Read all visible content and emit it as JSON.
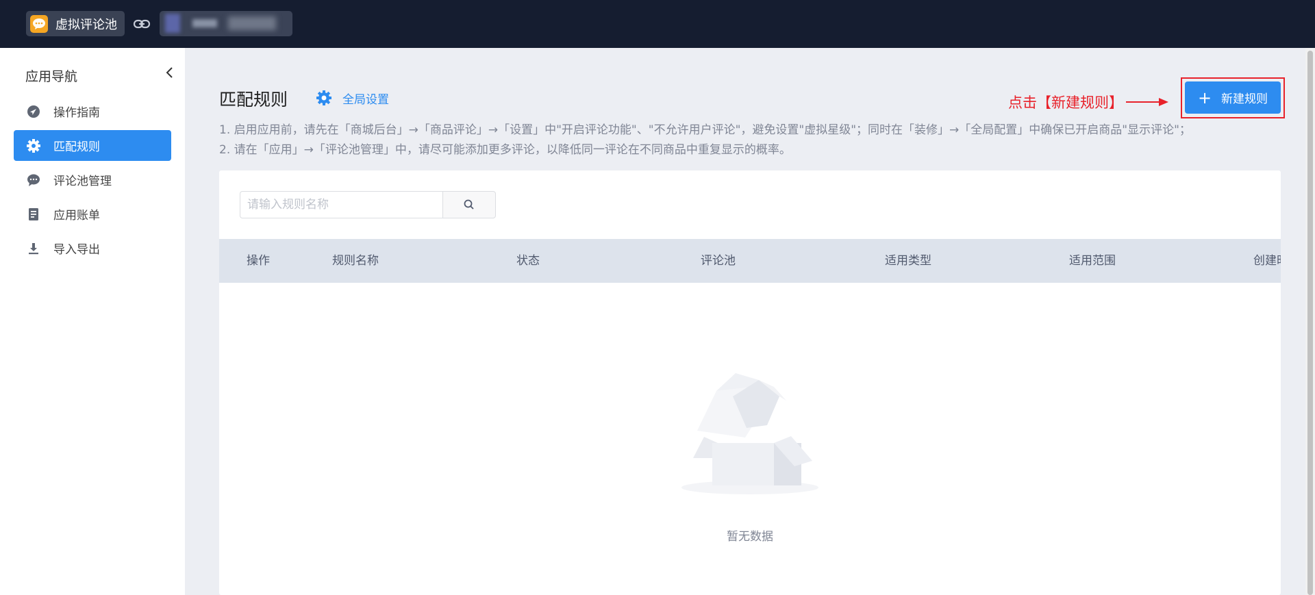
{
  "topbar": {
    "app_name": "虚拟评论池",
    "app_logo_icon": "chat-bubble-icon",
    "link_icon": "link-icon",
    "store_name": ""
  },
  "sidebar": {
    "title": "应用导航",
    "items": [
      {
        "label": "操作指南",
        "icon": "navigation-arrow-icon",
        "active": false
      },
      {
        "label": "匹配规则",
        "icon": "gear-icon",
        "active": true
      },
      {
        "label": "评论池管理",
        "icon": "comment-icon",
        "active": false
      },
      {
        "label": "应用账单",
        "icon": "bill-icon",
        "active": false
      },
      {
        "label": "导入导出",
        "icon": "download-icon",
        "active": false
      }
    ]
  },
  "main": {
    "title": "匹配规则",
    "global_settings": "全局设置",
    "annotation": "点击【新建规则】",
    "new_rule_button": "新建规则",
    "notes": [
      "1. 启用应用前，请先在「商城后台」→「商品评论」→「设置」中\"开启评论功能\"、\"不允许用户评论\"，避免设置\"虚拟星级\"；同时在「装修」→「全局配置」中确保已开启商品\"显示评论\"；",
      "2. 请在「应用」→「评论池管理」中，请尽可能添加更多评论，以降低同一评论在不同商品中重复显示的概率。"
    ],
    "search": {
      "placeholder": "请输入规则名称",
      "value": ""
    },
    "table": {
      "columns": [
        "操作",
        "规则名称",
        "状态",
        "评论池",
        "适用类型",
        "适用范围",
        "创建时间"
      ]
    },
    "empty_text": "暂无数据"
  },
  "colors": {
    "primary": "#2d8cf0",
    "topbar": "#151d30",
    "annotation": "#e8212a"
  }
}
